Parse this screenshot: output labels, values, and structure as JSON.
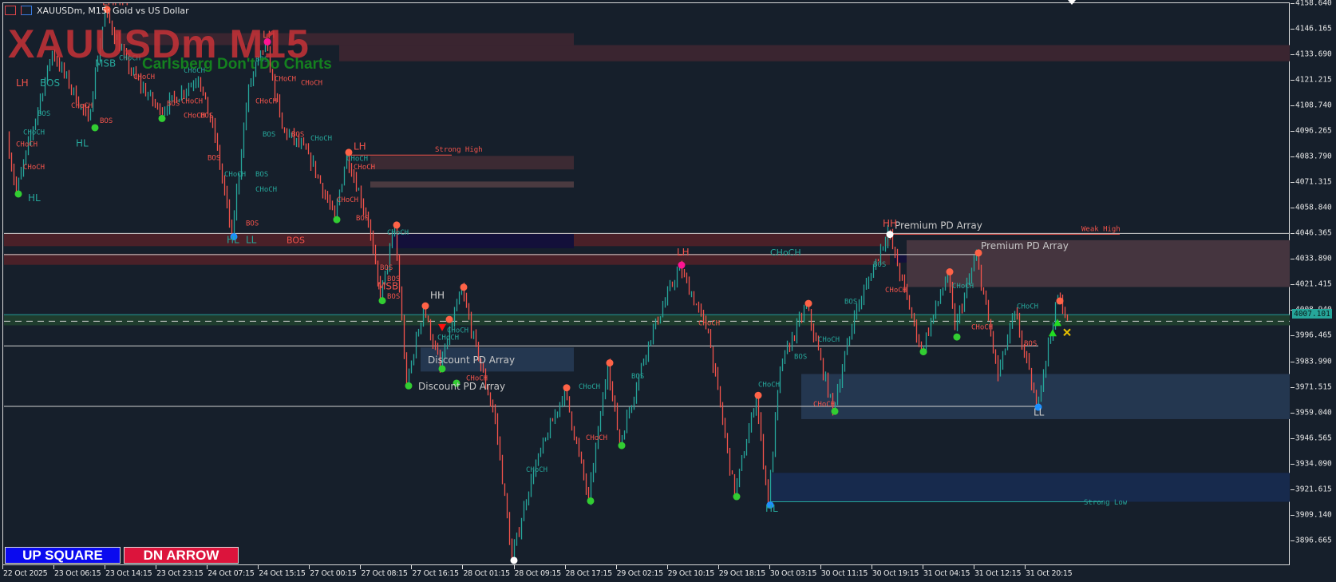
{
  "window": {
    "title": "XAUUSDm, M15:  Gold vs US Dollar"
  },
  "watermark": {
    "symbol_tf": "XAUUSDm M15",
    "tagline": "Carlsberg Don't Do Charts"
  },
  "buttons": {
    "up": "UP SQUARE",
    "down": "DN ARROW"
  },
  "colors": {
    "up": "#26a69a",
    "down": "#f2534b",
    "background": "#161f2b",
    "swing_high": "#ff6347",
    "swing_low": "#32cd32",
    "swing_key": "#1e90ff"
  },
  "price_axis": {
    "labels": [
      "4158.640",
      "4146.165",
      "4133.690",
      "4121.215",
      "4108.740",
      "4096.265",
      "4083.790",
      "4071.315",
      "4058.840",
      "4046.365",
      "4033.890",
      "4021.415",
      "4008.940",
      "3996.465",
      "3983.990",
      "3971.515",
      "3959.040",
      "3946.565",
      "3934.090",
      "3921.615",
      "3909.140",
      "3896.665"
    ],
    "current_price": "4007.101"
  },
  "time_axis": {
    "labels": [
      "22 Oct 2025",
      "23 Oct 06:15",
      "23 Oct 14:15",
      "23 Oct 23:15",
      "24 Oct 07:15",
      "24 Oct 15:15",
      "27 Oct 00:15",
      "27 Oct 08:15",
      "27 Oct 16:15",
      "28 Oct 01:15",
      "28 Oct 09:15",
      "28 Oct 17:15",
      "29 Oct 02:15",
      "29 Oct 10:15",
      "29 Oct 18:15",
      "30 Oct 03:15",
      "30 Oct 11:15",
      "30 Oct 19:15",
      "31 Oct 04:15",
      "31 Oct 12:15",
      "31 Oct 20:15"
    ]
  },
  "chart_data": {
    "type": "candlestick",
    "symbol": "XAUUSDm",
    "timeframe": "M15",
    "ylim": [
      3890,
      4160
    ],
    "swing_path": [
      [
        2,
        4093.7
      ],
      [
        6,
        4066.7
      ],
      [
        21,
        4135.2
      ],
      [
        36,
        4102
      ],
      [
        43,
        4155.1
      ],
      [
        53,
        4126.9
      ],
      [
        66,
        4106.1
      ],
      [
        82,
        4122.7
      ],
      [
        89,
        4093.7
      ],
      [
        96,
        4045.9
      ],
      [
        103,
        4118.6
      ],
      [
        110,
        4139.3
      ],
      [
        117,
        4097.8
      ],
      [
        128,
        4085.4
      ],
      [
        139,
        4054.2
      ],
      [
        144,
        4085.4
      ],
      [
        153,
        4052.1
      ],
      [
        158,
        4014.7
      ],
      [
        164,
        4050.0
      ],
      [
        169,
        3973.2
      ],
      [
        176,
        4010.6
      ],
      [
        183,
        3981.5
      ],
      [
        192,
        4019.7
      ],
      [
        199,
        3985.7
      ],
      [
        206,
        3956.6
      ],
      [
        213,
        3888.1
      ],
      [
        221,
        3927.5
      ],
      [
        235,
        3970.7
      ],
      [
        245,
        3917.1
      ],
      [
        253,
        3982.8
      ],
      [
        258,
        3944.1
      ],
      [
        270,
        3994.0
      ],
      [
        283,
        4030.5
      ],
      [
        295,
        3998.1
      ],
      [
        306,
        3919.2
      ],
      [
        315,
        3967.0
      ],
      [
        320,
        3915.1
      ],
      [
        325,
        3981.5
      ],
      [
        336,
        4011.8
      ],
      [
        347,
        3960.8
      ],
      [
        356,
        4006.4
      ],
      [
        370,
        4048.0
      ],
      [
        384,
        3989.8
      ],
      [
        395,
        4027.2
      ],
      [
        398,
        4000.2
      ],
      [
        407,
        4036.4
      ],
      [
        416,
        3977.4
      ],
      [
        423,
        4008.5
      ],
      [
        432,
        3962.8
      ],
      [
        441,
        4015.6
      ],
      [
        445,
        4006.4
      ]
    ],
    "zones": [
      {
        "name": "supply-zone",
        "b0": 46,
        "b1": 238,
        "p0": 4144.3,
        "p1": 4138.5,
        "color": "#3a2530"
      },
      {
        "name": "supply-zone",
        "b0": 140,
        "b1": 537,
        "p0": 4138.5,
        "p1": 4130.6,
        "color": "#3a2530"
      },
      {
        "name": "supply-zone",
        "b0": 153,
        "b1": 238,
        "p0": 4084.5,
        "p1": 4077.9,
        "color": "#3c2a33"
      },
      {
        "name": "supply-zone",
        "b0": 153,
        "b1": 238,
        "p0": 4072.0,
        "p1": 4069.1,
        "color": "#4a3a40"
      },
      {
        "name": "order-block",
        "b0": 0,
        "b1": 370,
        "p0": 4046.7,
        "p1": 4040.5,
        "color": "#4a2028"
      },
      {
        "name": "order-block",
        "b0": 0,
        "b1": 370,
        "p0": 4036.8,
        "p1": 4031.4,
        "color": "#4a2028"
      },
      {
        "name": "breaker-block",
        "b0": 162,
        "b1": 238,
        "p0": 4046.5,
        "p1": 4039.5,
        "color": "#13103a"
      },
      {
        "name": "breaker-block",
        "b0": 372,
        "b1": 407,
        "p0": 4036.5,
        "p1": 4032.5,
        "color": "#13103a"
      },
      {
        "name": "premium-zone",
        "b0": 377,
        "b1": 537,
        "p0": 4043.4,
        "p1": 4020.6,
        "color": "#45353f"
      },
      {
        "name": "equilibrium-band",
        "b0": 0,
        "b1": 537,
        "p0": 4006.8,
        "p1": 4001.9,
        "color": "#1f3d2e"
      },
      {
        "name": "discount-zone",
        "b0": 174,
        "b1": 238,
        "p0": 3991.1,
        "p1": 3979.4,
        "color": "#243750"
      },
      {
        "name": "discount-zone",
        "b0": 333,
        "b1": 537,
        "p0": 3978.2,
        "p1": 3956.2,
        "color": "#243750"
      },
      {
        "name": "strong-low-zone",
        "b0": 320,
        "b1": 537,
        "p0": 3930.0,
        "p1": 3915.9,
        "color": "#172a4d"
      }
    ],
    "lines": [
      {
        "name": "current-price-line",
        "b0": 0,
        "b1": 537,
        "p": 4007.1,
        "color": "#26a69a",
        "dash": false
      },
      {
        "name": "equilibrium-line",
        "b0": 0,
        "b1": 537,
        "p": 4003.9,
        "color": "#d0d0d0",
        "dash": true
      },
      {
        "name": "level-line",
        "b0": 0,
        "b1": 537,
        "p": 4046.7,
        "color": "#d0d0d0",
        "dash": false
      },
      {
        "name": "level-line",
        "b0": 0,
        "b1": 407,
        "p": 4036.4,
        "color": "#d0d0d0",
        "dash": false
      },
      {
        "name": "level-line",
        "b0": 0,
        "b1": 432,
        "p": 3991.9,
        "color": "#d0d0d0",
        "dash": false
      },
      {
        "name": "level-line",
        "b0": 0,
        "b1": 432,
        "p": 3962.4,
        "color": "#d0d0d0",
        "dash": false
      },
      {
        "name": "strong-high-line",
        "b0": 144,
        "b1": 187,
        "p": 4084.9,
        "color": "#f2534b",
        "dash": false
      },
      {
        "name": "weak-high-line",
        "b0": 370,
        "b1": 466,
        "p": 4046.3,
        "color": "#f2534b",
        "dash": false
      },
      {
        "name": "strong-low-line",
        "b0": 320,
        "b1": 459,
        "p": 3915.9,
        "color": "#26a69a",
        "dash": false
      }
    ],
    "labels": [
      {
        "t": "Strong High",
        "b": 180,
        "p": 4086.5,
        "c": "#f2534b",
        "s": 9
      },
      {
        "t": "Weak High",
        "b": 450,
        "p": 4047.8,
        "c": "#f2534b",
        "s": 9
      },
      {
        "t": "Strong Low",
        "b": 451,
        "p": 3914.6,
        "c": "#26a69a",
        "s": 9
      },
      {
        "t": "Premium PD Array",
        "b": 372,
        "p": 4049.0,
        "c": "#c8c8c8",
        "s": 12
      },
      {
        "t": "Premium PD Array",
        "b": 408,
        "p": 4039.0,
        "c": "#c8c8c8",
        "s": 12
      },
      {
        "t": "Discount PD Array",
        "b": 177,
        "p": 3983.5,
        "c": "#c8c8c8",
        "s": 12
      },
      {
        "t": "Discount PD Array",
        "b": 173,
        "p": 3970.5,
        "c": "#c8c8c8",
        "s": 12
      },
      {
        "t": "LH",
        "b": 5,
        "p": 4118.5,
        "c": "#f2534b",
        "s": 12
      },
      {
        "t": "BOS",
        "b": 15,
        "p": 4118.5,
        "c": "#26a69a",
        "s": 12
      },
      {
        "t": "HL",
        "b": 30,
        "p": 4089.0,
        "c": "#26a69a",
        "s": 12
      },
      {
        "t": "HL",
        "b": 10,
        "p": 4062.5,
        "c": "#26a69a",
        "s": 12
      },
      {
        "t": "MSB",
        "b": 38,
        "p": 4128.0,
        "c": "#26a69a",
        "s": 12
      },
      {
        "t": "LH",
        "b": 146,
        "p": 4087.5,
        "c": "#f2534b",
        "s": 12
      },
      {
        "t": "BOS",
        "b": 118,
        "p": 4042.0,
        "c": "#f2534b",
        "s": 11
      },
      {
        "t": "HL",
        "b": 93,
        "p": 4042.0,
        "c": "#26a69a",
        "s": 12
      },
      {
        "t": "LL",
        "b": 101,
        "p": 4042.0,
        "c": "#26a69a",
        "s": 12
      },
      {
        "t": "HH",
        "b": 178,
        "p": 4015.0,
        "c": "#d0d0d0",
        "s": 12
      },
      {
        "t": "MSB",
        "b": 156,
        "p": 4019.5,
        "c": "#f2534b",
        "s": 12
      },
      {
        "t": "LH",
        "b": 281,
        "p": 4036.0,
        "c": "#f2534b",
        "s": 12
      },
      {
        "t": "CHoCH",
        "b": 320,
        "p": 4036.0,
        "c": "#26a69a",
        "s": 11
      },
      {
        "t": "HH",
        "b": 367,
        "p": 4050.0,
        "c": "#f2534b",
        "s": 12
      },
      {
        "t": "HL",
        "b": 318,
        "p": 3911.0,
        "c": "#26a69a",
        "s": 12
      },
      {
        "t": "LL",
        "b": 430,
        "p": 3958.0,
        "c": "#c8c8c8",
        "s": 12
      },
      {
        "t": "CHoCH",
        "b": 218,
        "p": 3930.5,
        "c": "#26a69a",
        "s": 9
      },
      {
        "t": "CHoCH",
        "b": 243,
        "p": 3946.0,
        "c": "#f2534b",
        "s": 9
      },
      {
        "t": "CHoCH",
        "b": 240,
        "p": 3971.0,
        "c": "#26a69a",
        "s": 9
      },
      {
        "t": "BOS",
        "b": 262,
        "p": 3976.0,
        "c": "#26a69a",
        "s": 9
      },
      {
        "t": "CHoCH",
        "b": 290,
        "p": 4002.0,
        "c": "#f2534b",
        "s": 9
      },
      {
        "t": "CHoCH",
        "b": 315,
        "p": 3972.0,
        "c": "#26a69a",
        "s": 9
      },
      {
        "t": "BOS",
        "b": 330,
        "p": 3985.5,
        "c": "#26a69a",
        "s": 9
      },
      {
        "t": "CHoCH",
        "b": 340,
        "p": 3994.0,
        "c": "#26a69a",
        "s": 9
      },
      {
        "t": "CHoCH",
        "b": 338,
        "p": 3962.5,
        "c": "#f2534b",
        "s": 9
      },
      {
        "t": "BOS",
        "b": 351,
        "p": 4012.5,
        "c": "#26a69a",
        "s": 9
      },
      {
        "t": "BOS",
        "b": 363,
        "p": 4030.5,
        "c": "#26a69a",
        "s": 9
      },
      {
        "t": "CHoCH",
        "b": 368,
        "p": 4018.0,
        "c": "#f2534b",
        "s": 9
      },
      {
        "t": "CHoCH",
        "b": 396,
        "p": 4020.0,
        "c": "#26a69a",
        "s": 9
      },
      {
        "t": "CHoCH",
        "b": 404,
        "p": 4000.0,
        "c": "#f2534b",
        "s": 9
      },
      {
        "t": "CHoCH",
        "b": 423,
        "p": 4010.0,
        "c": "#26a69a",
        "s": 9
      },
      {
        "t": "BOS",
        "b": 426,
        "p": 3992.0,
        "c": "#f2534b",
        "s": 9
      },
      {
        "t": "BOS",
        "b": 147,
        "p": 4053.0,
        "c": "#f2534b",
        "s": 9
      },
      {
        "t": "CHoCH",
        "b": 146,
        "p": 4078.0,
        "c": "#f2534b",
        "s": 9
      },
      {
        "t": "CHoCH",
        "b": 139,
        "p": 4062.0,
        "c": "#f2534b",
        "s": 9
      },
      {
        "t": "CHoCH",
        "b": 160,
        "p": 4046.0,
        "c": "#26a69a",
        "s": 9
      },
      {
        "t": "BOS",
        "b": 157,
        "p": 4029.0,
        "c": "#f2534b",
        "s": 9
      },
      {
        "t": "BOS",
        "b": 160,
        "p": 4023.5,
        "c": "#f2534b",
        "s": 9
      },
      {
        "t": "BOS",
        "b": 160,
        "p": 4015.0,
        "c": "#f2534b",
        "s": 9
      },
      {
        "t": "CHoCH",
        "b": 181,
        "p": 3995.0,
        "c": "#26a69a",
        "s": 9
      },
      {
        "t": "CHoCH",
        "b": 185,
        "p": 3998.5,
        "c": "#26a69a",
        "s": 9
      },
      {
        "t": "CHoCH",
        "b": 193,
        "p": 3975.0,
        "c": "#f2534b",
        "s": 9
      },
      {
        "t": "BOS",
        "b": 85,
        "p": 4082.5,
        "c": "#f2534b",
        "s": 9
      },
      {
        "t": "CHoCH",
        "b": 92,
        "p": 4074.5,
        "c": "#26a69a",
        "s": 9
      },
      {
        "t": "BOS",
        "b": 105,
        "p": 4074.5,
        "c": "#26a69a",
        "s": 9
      },
      {
        "t": "CHoCH",
        "b": 105,
        "p": 4067.0,
        "c": "#26a69a",
        "s": 9
      },
      {
        "t": "BOS",
        "b": 101,
        "p": 4050.5,
        "c": "#f2534b",
        "s": 9
      },
      {
        "t": "BOS",
        "b": 108,
        "p": 4094.0,
        "c": "#26a69a",
        "s": 9
      },
      {
        "t": "BOS",
        "b": 120,
        "p": 4094.0,
        "c": "#f2534b",
        "s": 9
      },
      {
        "t": "CHoCH",
        "b": 105,
        "p": 4110.0,
        "c": "#f2534b",
        "s": 9
      },
      {
        "t": "CHoCH",
        "b": 124,
        "p": 4119.0,
        "c": "#f2534b",
        "s": 9
      },
      {
        "t": "CHoCH",
        "b": 128,
        "p": 4092.0,
        "c": "#26a69a",
        "s": 9
      },
      {
        "t": "CHoCH",
        "b": 143,
        "p": 4082.0,
        "c": "#26a69a",
        "s": 9
      },
      {
        "t": "CHoCH",
        "b": 74,
        "p": 4110.0,
        "c": "#f2534b",
        "s": 9
      },
      {
        "t": "CHoCH",
        "b": 75,
        "p": 4103.0,
        "c": "#f2534b",
        "s": 9
      },
      {
        "t": "BOS",
        "b": 82,
        "p": 4103.0,
        "c": "#f2534b",
        "s": 9
      },
      {
        "t": "BOS",
        "b": 68,
        "p": 4109.0,
        "c": "#f2534b",
        "s": 9
      },
      {
        "t": "BOS",
        "b": 40,
        "p": 4100.5,
        "c": "#f2534b",
        "s": 9
      },
      {
        "t": "CHoCH",
        "b": 28,
        "p": 4108.0,
        "c": "#f2534b",
        "s": 9
      },
      {
        "t": "BOS",
        "b": 14,
        "p": 4104.0,
        "c": "#26a69a",
        "s": 9
      },
      {
        "t": "CHoCH",
        "b": 8,
        "p": 4095.0,
        "c": "#26a69a",
        "s": 9
      },
      {
        "t": "CHoCH",
        "b": 5,
        "p": 4089.0,
        "c": "#f2534b",
        "s": 9
      },
      {
        "t": "CHoCH",
        "b": 8,
        "p": 4078.0,
        "c": "#f2534b",
        "s": 9
      },
      {
        "t": "CHoCH",
        "b": 48,
        "p": 4131.0,
        "c": "#26a69a",
        "s": 9
      },
      {
        "t": "CHoCH",
        "b": 54,
        "p": 4122.0,
        "c": "#f2534b",
        "s": 9
      },
      {
        "t": "CHoCH",
        "b": 75,
        "p": 4125.0,
        "c": "#26a69a",
        "s": 9
      },
      {
        "t": "BOS",
        "b": 105,
        "p": 4130.5,
        "c": "#26a69a",
        "s": 9
      },
      {
        "t": "CHoCH",
        "b": 113,
        "p": 4121.0,
        "c": "#f2534b",
        "s": 9
      },
      {
        "t": "LH",
        "b": 41,
        "p": 4158.0,
        "c": "#f2534b",
        "s": 12
      },
      {
        "t": "HH",
        "b": 46,
        "p": 4158.0,
        "c": "#f2534b",
        "s": 12
      },
      {
        "t": "LH",
        "b": 108,
        "p": 4142.0,
        "c": "#f2534b",
        "s": 12
      }
    ],
    "swing_markers": [
      {
        "b": 43,
        "p": 4155.1,
        "k": "high"
      },
      {
        "b": 66,
        "p": 4103.5,
        "k": "low"
      },
      {
        "b": 38,
        "p": 4099.0,
        "k": "low"
      },
      {
        "b": 6,
        "p": 4066.7,
        "k": "low"
      },
      {
        "b": 110,
        "p": 4139.3,
        "k": "pink"
      },
      {
        "b": 96,
        "p": 4045.9,
        "k": "key"
      },
      {
        "b": 139,
        "p": 4054.2,
        "k": "low"
      },
      {
        "b": 144,
        "p": 4085.4,
        "k": "high"
      },
      {
        "b": 164,
        "p": 4050.0,
        "k": "high"
      },
      {
        "b": 158,
        "p": 4014.7,
        "k": "low"
      },
      {
        "b": 169,
        "p": 3973.2,
        "k": "low"
      },
      {
        "b": 176,
        "p": 4010.6,
        "k": "high"
      },
      {
        "b": 183,
        "p": 3981.5,
        "k": "low"
      },
      {
        "b": 192,
        "p": 4019.7,
        "k": "high"
      },
      {
        "b": 189,
        "p": 3974.5,
        "k": "low"
      },
      {
        "b": 186,
        "p": 4004.0,
        "k": "high"
      },
      {
        "b": 235,
        "p": 3970.7,
        "k": "high"
      },
      {
        "b": 245,
        "p": 3917.1,
        "k": "low"
      },
      {
        "b": 253,
        "p": 3982.8,
        "k": "high"
      },
      {
        "b": 258,
        "p": 3944.1,
        "k": "low"
      },
      {
        "b": 283,
        "p": 4030.5,
        "k": "pink"
      },
      {
        "b": 306,
        "p": 3919.2,
        "k": "low"
      },
      {
        "b": 315,
        "p": 3967.0,
        "k": "high"
      },
      {
        "b": 320,
        "p": 3915.1,
        "k": "key"
      },
      {
        "b": 336,
        "p": 4011.8,
        "k": "high"
      },
      {
        "b": 347,
        "p": 3960.8,
        "k": "low"
      },
      {
        "b": 384,
        "p": 3989.8,
        "k": "low"
      },
      {
        "b": 395,
        "p": 4027.2,
        "k": "high"
      },
      {
        "b": 398,
        "p": 3997.0,
        "k": "low"
      },
      {
        "b": 407,
        "p": 4036.4,
        "k": "high"
      },
      {
        "b": 432,
        "p": 3962.8,
        "k": "key"
      },
      {
        "b": 441,
        "p": 4013.0,
        "k": "high"
      },
      {
        "b": 370,
        "p": 4047.0,
        "k": "white"
      },
      {
        "b": 213,
        "p": 3888.1,
        "k": "white"
      }
    ],
    "signals": [
      {
        "b": 440,
        "p": 4003.5,
        "k": "up-triangle"
      },
      {
        "b": 438,
        "p": 3998.5,
        "k": "up-triangle"
      },
      {
        "b": 444,
        "p": 3998.5,
        "k": "cross"
      },
      {
        "b": 183,
        "p": 4001.0,
        "k": "down-triangle"
      }
    ]
  }
}
